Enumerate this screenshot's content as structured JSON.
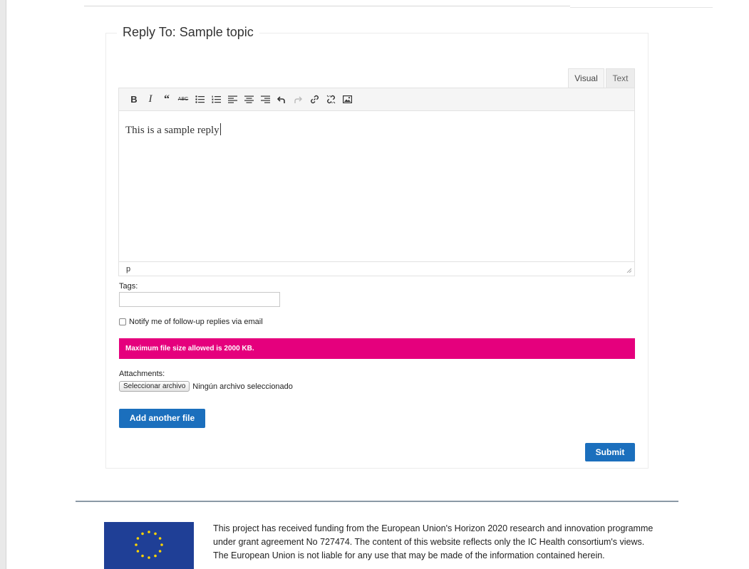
{
  "form": {
    "title": "Reply To: Sample topic",
    "editor": {
      "tabs": [
        {
          "label": "Visual",
          "active": true
        },
        {
          "label": "Text",
          "active": false
        }
      ],
      "toolbar": [
        "bold-icon",
        "italic-icon",
        "blockquote-icon",
        "strikethrough-icon",
        "bullet-list-icon",
        "numbered-list-icon",
        "align-left-icon",
        "align-center-icon",
        "align-right-icon",
        "undo-icon",
        "redo-icon",
        "link-icon",
        "unlink-icon",
        "image-icon"
      ],
      "content": "This is a sample reply",
      "path": "p"
    },
    "tags_label": "Tags:",
    "tags_value": "",
    "notify_label": "Notify me of follow-up replies via email",
    "notify_checked": false,
    "alert_text": "Maximum file size allowed is 2000 KB.",
    "alert_color": "#e5007d",
    "attachments_label": "Attachments:",
    "file_button_label": "Seleccionar archivo",
    "file_status": "Ningún archivo seleccionado",
    "add_file_label": "Add another file",
    "submit_label": "Submit",
    "accent_color": "#1b6fbd"
  },
  "footer": {
    "text": "This project has received funding from the European Union's Horizon 2020 research and innovation programme under grant agreement No 727474. The content of this website reflects only the IC Health consortium's views. The European Union is not liable for any use that may be made of the information contained herein."
  }
}
